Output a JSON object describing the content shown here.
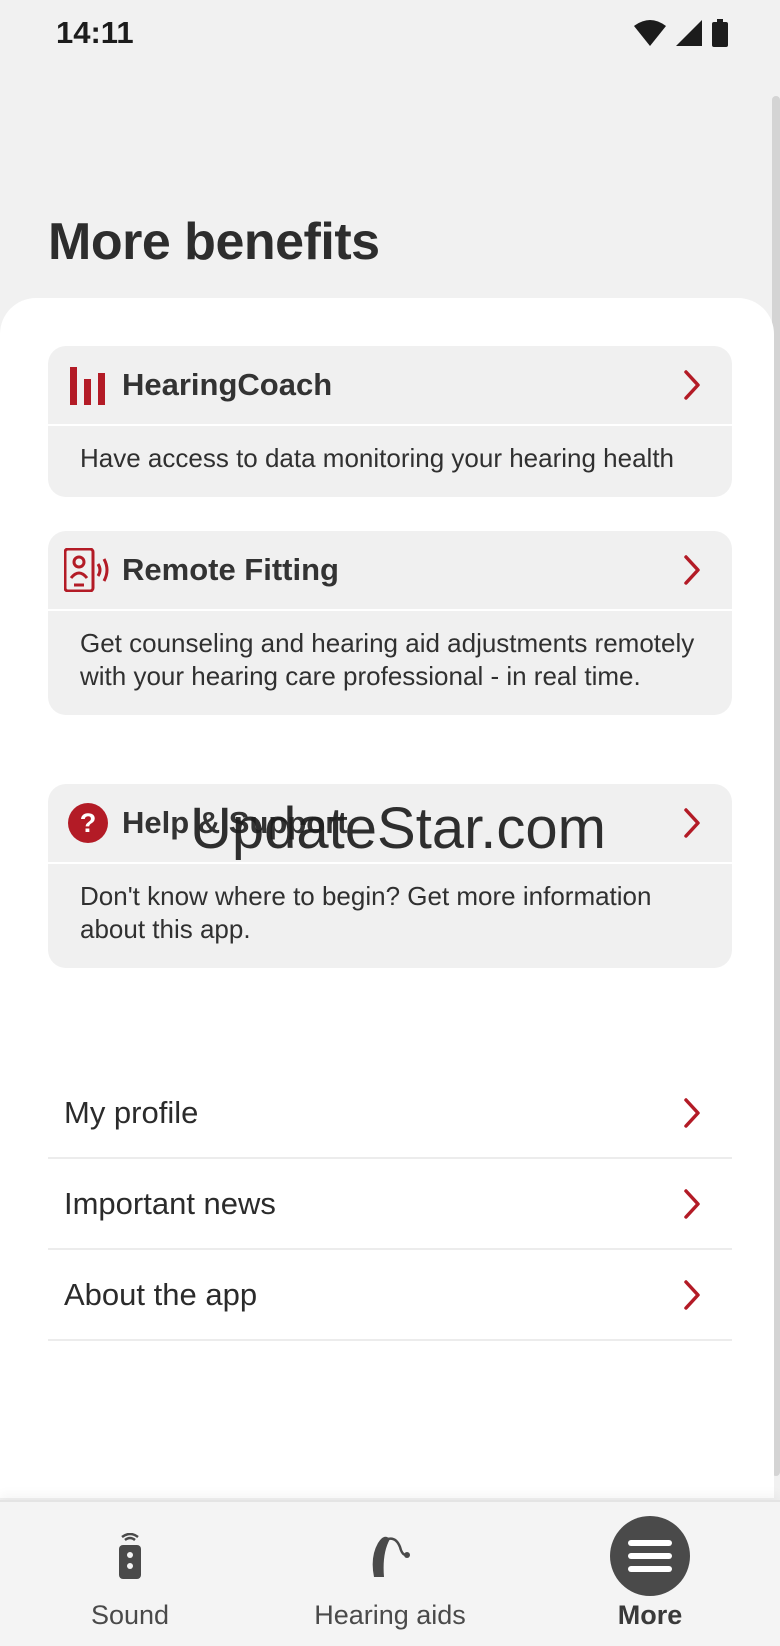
{
  "status_bar": {
    "time": "14:11"
  },
  "page": {
    "title": "More benefits"
  },
  "cards": [
    {
      "title": "HearingCoach",
      "icon": "bar-chart-icon",
      "description": "Have access to data monitoring your hearing health"
    },
    {
      "title": "Remote Fitting",
      "icon": "remote-fitting-icon",
      "description": "Get counseling and hearing aid adjustments remotely with your hearing care professional - in real time."
    },
    {
      "title": "Help & Support",
      "icon": "help-icon",
      "description": "Don't know where to begin? Get more information about this app."
    }
  ],
  "list": [
    {
      "label": "My profile"
    },
    {
      "label": "Important news"
    },
    {
      "label": "About the app"
    }
  ],
  "watermark": "UpdateStar.com",
  "bottom_nav": {
    "items": [
      {
        "label": "Sound",
        "icon": "remote-control-icon"
      },
      {
        "label": "Hearing aids",
        "icon": "hearing-aid-icon"
      },
      {
        "label": "More",
        "icon": "menu-icon",
        "active": true
      }
    ]
  },
  "colors": {
    "accent": "#b31b26",
    "background": "#f1f1f1",
    "card": "#f0f0f0",
    "nav_active": "#4a4a4a"
  }
}
